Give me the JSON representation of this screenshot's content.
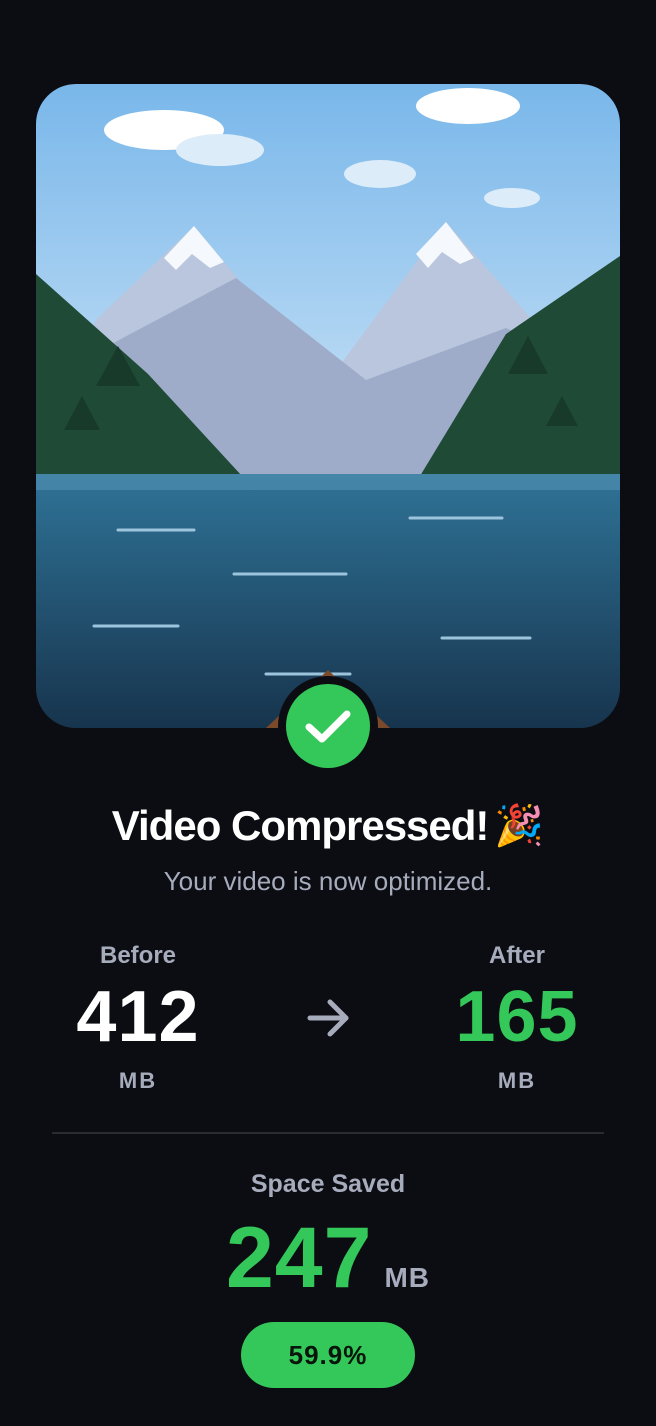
{
  "result": {
    "title": "Video Compressed!",
    "title_emoji": "🎉",
    "subtitle": "Your video is now optimized."
  },
  "stats": {
    "before": {
      "label": "Before",
      "value": "412",
      "unit": "MB"
    },
    "after": {
      "label": "After",
      "value": "165",
      "unit": "MB"
    }
  },
  "savings": {
    "label": "Space Saved",
    "value": "247",
    "unit": "MB",
    "percent": "59.9%"
  },
  "icons": {
    "success": "check-circle-icon",
    "compare": "arrow-right-icon",
    "celebrate": "party-popper-icon"
  },
  "colors": {
    "background": "#0c0d12",
    "accent_green": "#34c759",
    "muted_text": "#a7acbd"
  }
}
